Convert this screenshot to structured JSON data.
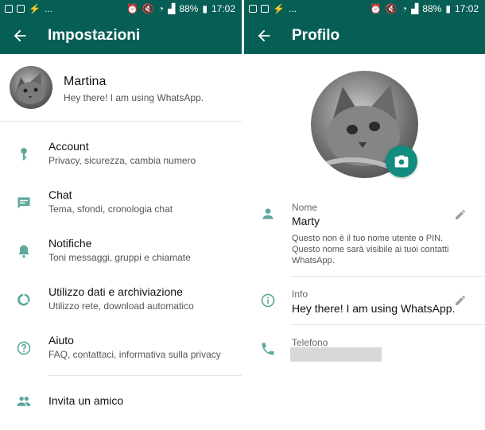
{
  "statusbar": {
    "dots": "...",
    "battery": "88%",
    "time": "17:02"
  },
  "left": {
    "title": "Impostazioni",
    "profile": {
      "name": "Martina",
      "status": "Hey there! I am using WhatsApp."
    },
    "items": [
      {
        "title": "Account",
        "subtitle": "Privacy, sicurezza, cambia numero",
        "icon": "key-icon"
      },
      {
        "title": "Chat",
        "subtitle": "Tema, sfondi, cronologia chat",
        "icon": "chat-icon"
      },
      {
        "title": "Notifiche",
        "subtitle": "Toni messaggi, gruppi e chiamate",
        "icon": "bell-icon"
      },
      {
        "title": "Utilizzo dati e archiviazione",
        "subtitle": "Utilizzo rete, download automatico",
        "icon": "data-usage-icon"
      },
      {
        "title": "Aiuto",
        "subtitle": "FAQ, contattaci, informativa sulla privacy",
        "icon": "help-icon"
      },
      {
        "title": "Invita un amico",
        "subtitle": "",
        "icon": "people-icon"
      }
    ]
  },
  "right": {
    "title": "Profilo",
    "name_field": {
      "label": "Nome",
      "value": "Marty",
      "note": "Questo non è il tuo nome utente o PIN. Questo nome sarà visibile ai tuoi contatti WhatsApp."
    },
    "info_field": {
      "label": "Info",
      "value": "Hey there! I am using WhatsApp."
    },
    "phone_field": {
      "label": "Telefono"
    }
  },
  "colors": {
    "header": "#075e54",
    "accent": "#128c7e",
    "icon": "#5fa89e"
  }
}
